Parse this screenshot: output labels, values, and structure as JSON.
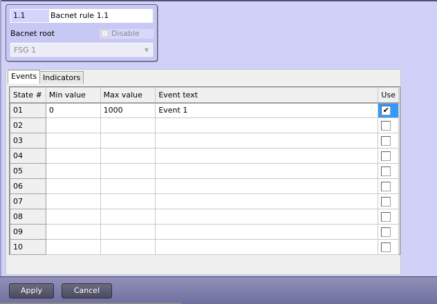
{
  "rule": {
    "id": "1.1",
    "name": "Bacnet rule 1.1",
    "root_label": "Bacnet root",
    "disable_label": "Disable",
    "disable_checked": false,
    "root_value": "FSG 1"
  },
  "tabs": [
    "Events",
    "Indicators"
  ],
  "grid": {
    "headers": [
      "State #",
      "Min value",
      "Max value",
      "Event text",
      "Use"
    ],
    "rows": [
      {
        "state": "01",
        "min": "0",
        "max": "1000",
        "text": "Event 1",
        "use": true
      },
      {
        "state": "02",
        "min": "",
        "max": "",
        "text": "",
        "use": false
      },
      {
        "state": "03",
        "min": "",
        "max": "",
        "text": "",
        "use": false
      },
      {
        "state": "04",
        "min": "",
        "max": "",
        "text": "",
        "use": false
      },
      {
        "state": "05",
        "min": "",
        "max": "",
        "text": "",
        "use": false
      },
      {
        "state": "06",
        "min": "",
        "max": "",
        "text": "",
        "use": false
      },
      {
        "state": "07",
        "min": "",
        "max": "",
        "text": "",
        "use": false
      },
      {
        "state": "08",
        "min": "",
        "max": "",
        "text": "",
        "use": false
      },
      {
        "state": "09",
        "min": "",
        "max": "",
        "text": "",
        "use": false
      },
      {
        "state": "10",
        "min": "",
        "max": "",
        "text": "",
        "use": false
      }
    ]
  },
  "buttons": {
    "apply": "Apply",
    "cancel": "Cancel"
  },
  "check_glyph": "✔"
}
